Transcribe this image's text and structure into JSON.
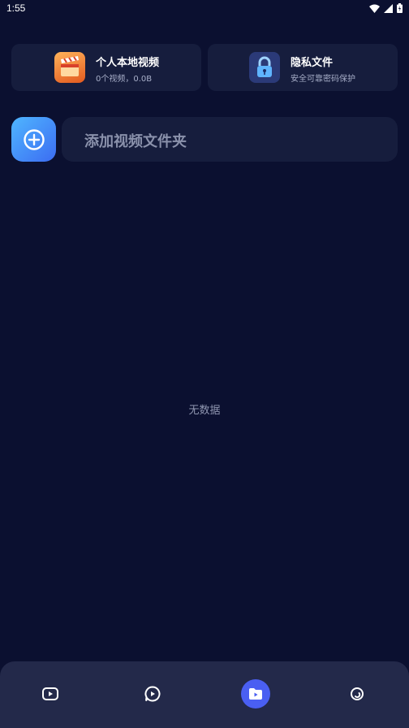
{
  "status_bar": {
    "time": "1:55"
  },
  "cards": {
    "local_video": {
      "title": "个人本地视频",
      "subtitle": "0个视频，0.0B",
      "icon": "clapperboard-icon"
    },
    "private_files": {
      "title": "隐私文件",
      "subtitle": "安全可靠密码保护",
      "icon": "lock-icon"
    }
  },
  "add_folder": {
    "label": "添加视频文件夹",
    "icon": "plus-circle-icon"
  },
  "empty_state": {
    "text": "无数据"
  },
  "bottom_nav": {
    "items": [
      {
        "icon": "video-play-icon",
        "active": false
      },
      {
        "icon": "chat-play-icon",
        "active": false
      },
      {
        "icon": "folder-play-icon",
        "active": true
      },
      {
        "icon": "profile-icon",
        "active": false
      }
    ]
  },
  "colors": {
    "background": "#0b1030",
    "card": "#161d3d",
    "accent": "#4a5ff2",
    "nav_bar": "#23294a"
  }
}
